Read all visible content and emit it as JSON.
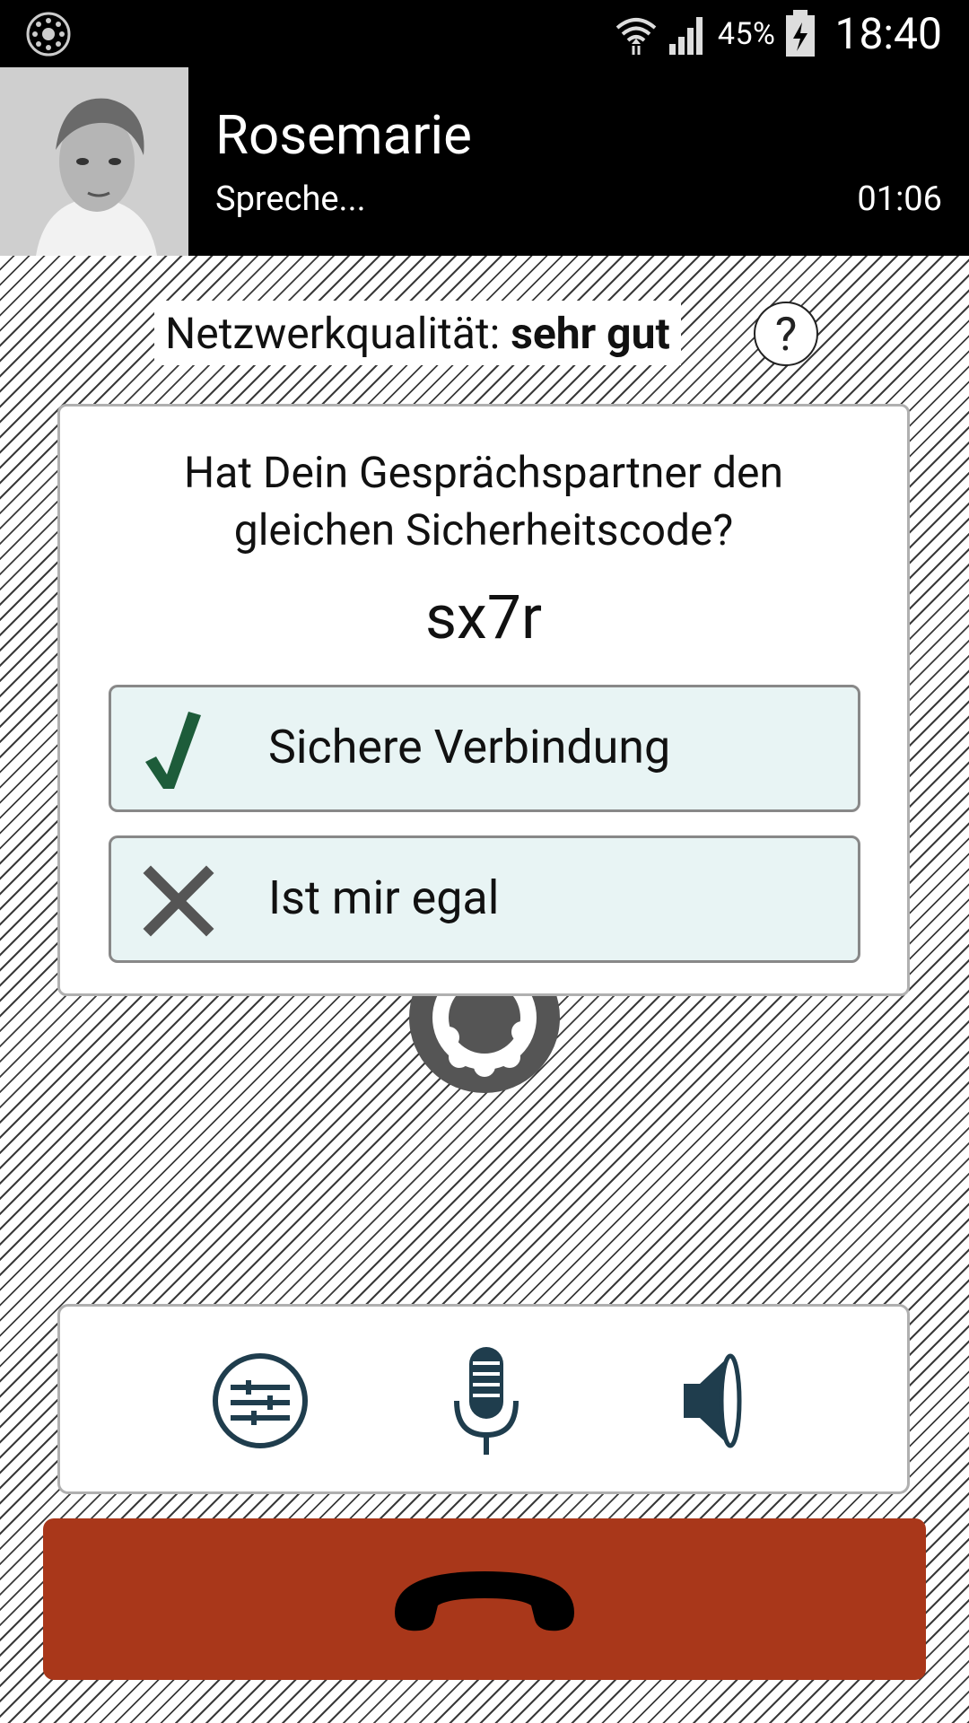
{
  "status_bar": {
    "battery": "45%",
    "time": "18:40"
  },
  "header": {
    "contact_name": "Rosemarie",
    "call_status": "Spreche...",
    "call_duration": "01:06"
  },
  "network": {
    "label": "Netzwerkqualität:",
    "value": "sehr gut",
    "help_symbol": "?"
  },
  "verification": {
    "question_line1": "Hat Dein Gesprächspartner den",
    "question_line2": "gleichen Sicherheitscode?",
    "code": "sx7r",
    "confirm_label": "Sichere Verbindung",
    "dismiss_label": "Ist mir egal"
  },
  "icons": {
    "app": "rotary-dial-icon",
    "wifi": "wifi-icon",
    "signal": "signal-icon",
    "battery": "battery-charging-icon",
    "confirm": "checkmark-icon",
    "dismiss": "x-icon",
    "settings": "sliders-icon",
    "microphone": "microphone-icon",
    "speaker": "speaker-icon",
    "hangup": "phone-hangup-icon"
  },
  "colors": {
    "hangup": "#a9371a",
    "icon_primary": "#1f3d4d",
    "check": "#1d5c3a",
    "option_bg": "#e8f4f4"
  }
}
